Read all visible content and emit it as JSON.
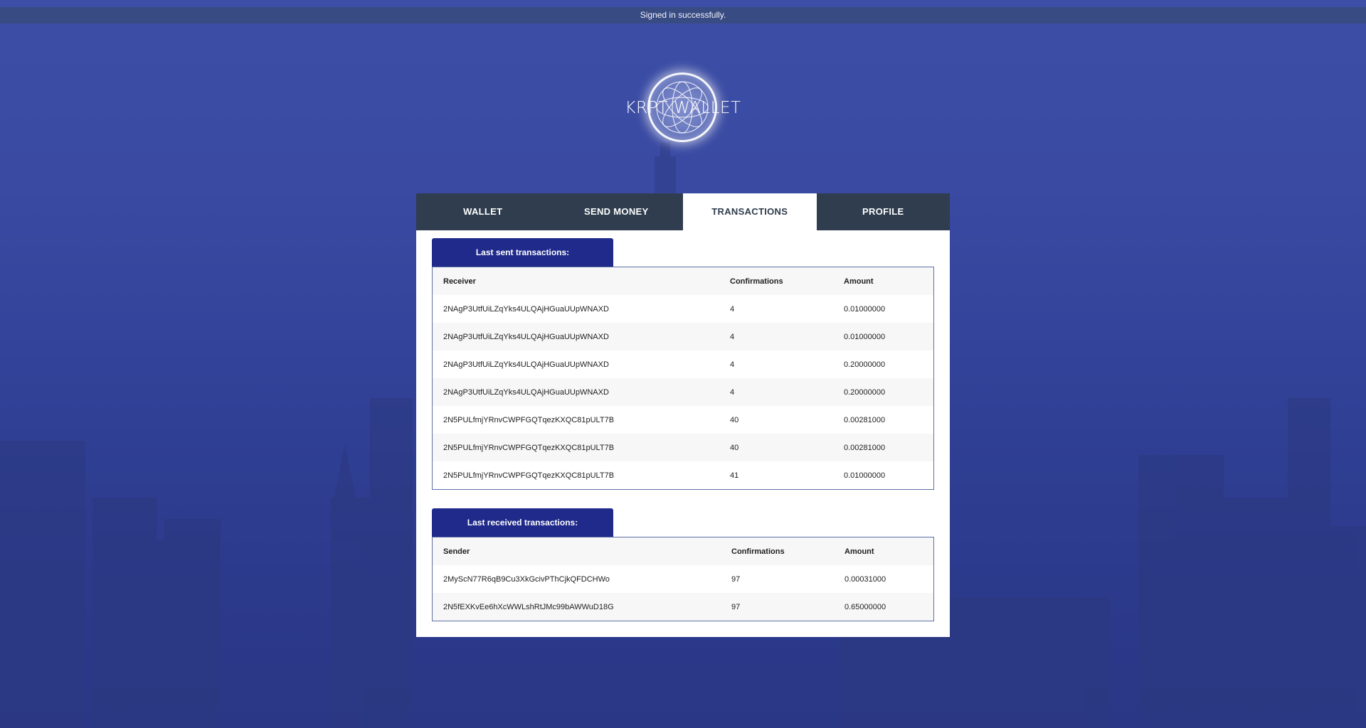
{
  "notification": "Signed in successfully.",
  "brand": {
    "title": "KRPT WALLET",
    "logo_icon": "globe-icon"
  },
  "tabs": [
    {
      "label": "WALLET",
      "active": false
    },
    {
      "label": "SEND MONEY",
      "active": false
    },
    {
      "label": "TRANSACTIONS",
      "active": true
    },
    {
      "label": "PROFILE",
      "active": false
    }
  ],
  "sent": {
    "heading": "Last sent transactions:",
    "columns": [
      "Receiver",
      "Confirmations",
      "Amount"
    ],
    "rows": [
      [
        "2NAgP3UtfUiLZqYks4ULQAjHGuaUUpWNAXD",
        "4",
        "0.01000000"
      ],
      [
        "2NAgP3UtfUiLZqYks4ULQAjHGuaUUpWNAXD",
        "4",
        "0.01000000"
      ],
      [
        "2NAgP3UtfUiLZqYks4ULQAjHGuaUUpWNAXD",
        "4",
        "0.20000000"
      ],
      [
        "2NAgP3UtfUiLZqYks4ULQAjHGuaUUpWNAXD",
        "4",
        "0.20000000"
      ],
      [
        "2N5PULfmjYRnvCWPFGQTqezKXQC81pULT7B",
        "40",
        "0.00281000"
      ],
      [
        "2N5PULfmjYRnvCWPFGQTqezKXQC81pULT7B",
        "40",
        "0.00281000"
      ],
      [
        "2N5PULfmjYRnvCWPFGQTqezKXQC81pULT7B",
        "41",
        "0.01000000"
      ]
    ]
  },
  "received": {
    "heading": "Last received transactions:",
    "columns": [
      "Sender",
      "Confirmations",
      "Amount"
    ],
    "rows": [
      [
        "2MyScN77R6qB9Cu3XkGcivPThCjkQFDCHWo",
        "97",
        "0.00031000"
      ],
      [
        "2N5fEXKvEe6hXcWWLshRtJMc99bAWWuD18G",
        "97",
        "0.65000000"
      ]
    ]
  },
  "colors": {
    "tab_bg": "#2f3d4e",
    "section_header_bg": "#1f2a8a",
    "background": "#34449b"
  }
}
